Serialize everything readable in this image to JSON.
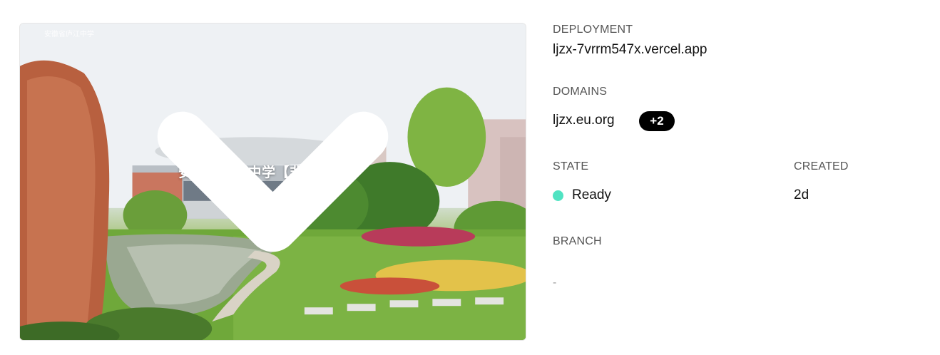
{
  "preview": {
    "title": "安徽省庐江中学【非官网】",
    "watermark": "安徽省庐江中学"
  },
  "deployment": {
    "label": "DEPLOYMENT",
    "url": "ljzx-7vrrm547x.vercel.app"
  },
  "domains": {
    "label": "DOMAINS",
    "primary": "ljzx.eu.org",
    "extra_badge": "+2"
  },
  "state": {
    "label": "STATE",
    "value": "Ready",
    "color": "#50e3c2"
  },
  "created": {
    "label": "CREATED",
    "value": "2d"
  },
  "branch": {
    "label": "BRANCH",
    "value": "-"
  },
  "icons": {
    "expand": "chevron-down-icon"
  }
}
